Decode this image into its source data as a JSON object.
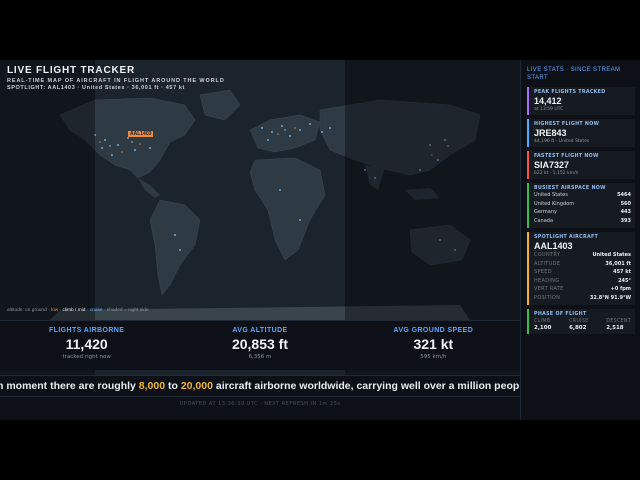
{
  "header": {
    "title": "LIVE FLIGHT TRACKER",
    "subtitle": "REAL-TIME MAP OF AIRCRAFT IN FLIGHT AROUND THE WORLD",
    "spotlight": "SPOTLIGHT: AAL1403 · United States · 36,001 ft · 457 kt"
  },
  "map": {
    "callout": "AAL1403",
    "legend": {
      "prefix": "altitude: on ground ·",
      "low": "low",
      "climb": "climb / mid",
      "cruise": "cruise",
      "suffix": "· shaded = night side"
    }
  },
  "stats": [
    {
      "label": "FLIGHTS AIRBORNE",
      "value": "11,420",
      "sub": "tracked right now"
    },
    {
      "label": "AVG ALTITUDE",
      "value": "20,853 ft",
      "sub": "6,356 m"
    },
    {
      "label": "AVG GROUND SPEED",
      "value": "321 kt",
      "sub": "595 km/h"
    }
  ],
  "ticker": {
    "pre": "n moment there are roughly ",
    "n1": "8,000",
    "mid": " to ",
    "n2": "20,000",
    "post": " aircraft airborne worldwide, carrying well over a million peop"
  },
  "updated": "UPDATED AT 13:36:39 UTC · NEXT REFRESH IN 1m 25s",
  "sidebar": {
    "header": "LIVE STATS · SINCE STREAM START",
    "peak": {
      "label": "PEAK FLIGHTS TRACKED",
      "value": "14,412",
      "sub": "at 13:59 UTC"
    },
    "highest": {
      "label": "HIGHEST FLIGHT NOW",
      "value": "JRE843",
      "sub": "44,196 ft · United States"
    },
    "fastest": {
      "label": "FASTEST FLIGHT NOW",
      "value": "SIA7327",
      "sub": "622 kt · 1,152 km/h"
    },
    "busiest": {
      "label": "BUSIEST AIRSPACE NOW",
      "rows": [
        {
          "k": "United States",
          "v": "5464"
        },
        {
          "k": "United Kingdom",
          "v": "560"
        },
        {
          "k": "Germany",
          "v": "443"
        },
        {
          "k": "Canada",
          "v": "393"
        }
      ]
    },
    "spot": {
      "label": "SPOTLIGHT AIRCRAFT",
      "value": "AAL1403",
      "rows": [
        {
          "k": "COUNTRY",
          "v": "United States"
        },
        {
          "k": "ALTITUDE",
          "v": "36,001 ft"
        },
        {
          "k": "SPEED",
          "v": "457 kt"
        },
        {
          "k": "HEADING",
          "v": "245°"
        },
        {
          "k": "VERT RATE",
          "v": "+0 fpm"
        },
        {
          "k": "POSITION",
          "v": "32.8°N 91.9°W"
        }
      ]
    },
    "phase": {
      "label": "PHASE OF FLIGHT",
      "cols": [
        {
          "k": "CLIMB",
          "v": "2,100"
        },
        {
          "k": "CRUISE",
          "v": "6,802"
        },
        {
          "k": "DESCENT",
          "v": "2,518"
        }
      ]
    }
  },
  "colors": {
    "accent": "#58a6ff",
    "highlight": "#f0b429",
    "low": "#f0883e",
    "cruise": "#79c0ff"
  }
}
